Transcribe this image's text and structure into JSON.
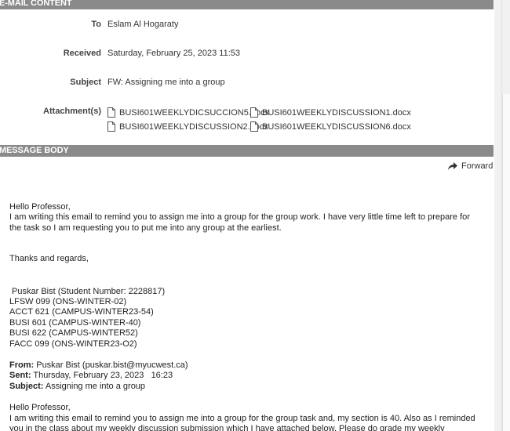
{
  "email_content": {
    "section_title": "E-MAIL CONTENT",
    "to_label": "To",
    "to_value": "Eslam Al Hogaraty",
    "received_label": "Received",
    "received_value": "Saturday, February 25, 2023   11:53",
    "subject_label": "Subject",
    "subject_value": "FW: Assigning me into a group",
    "attachments_label": "Attachment(s)",
    "attachments": [
      "BUSI601WEEKLYDICSUCCION5.docx",
      "BUSI601WEEKLYDISCUSSION1.docx",
      "BUSI601WEEKLYDISCUSSION2.docx",
      "BUSI601WEEKLYDISCUSSION6.docx"
    ],
    "attachment_icon": "document-icon"
  },
  "message_body": {
    "section_title": "MESSAGE BODY",
    "forward_label": "Forward",
    "forward_icon": "forward-arrow-icon",
    "greeting": "Hello Professor,",
    "paragraph1": "I am writing this email to remind you to assign me into a group for the group work. I have very little time left to prepare for the task so I am requesting you to put me into any group at the earliest.",
    "closing": "Thanks and regards,",
    "signature": [
      " Puskar Bist (Student Number: 2228817)",
      "LFSW 099 (ONS-WINTER-02)",
      "ACCT 621 (CAMPUS-WINTER23-54)",
      "BUSI 601 (CAMPUS-WINTER-40)",
      "BUSI 622 (CAMPUS-WINTER52)",
      "FACC 099 (ONS-WINTER23-O2)"
    ],
    "fwd_from_label": "From:",
    "fwd_from_value": " Puskar Bist (puskar.bist@myucwest.ca)",
    "fwd_sent_label": "Sent:",
    "fwd_sent_value": " Thursday, February 23, 2023   16:23",
    "fwd_subject_label": "Subject:",
    "fwd_subject_value": " Assigning me into a group",
    "fwd_greeting": "Hello Professor,",
    "fwd_paragraph": "I am writing this email to remind you to assign me into a group for the group task and, my section is 40. Also as I reminded you in the class about my weekly discussion submission which I have attached below. Please do grade my weekly discussions and assign me in a group."
  }
}
